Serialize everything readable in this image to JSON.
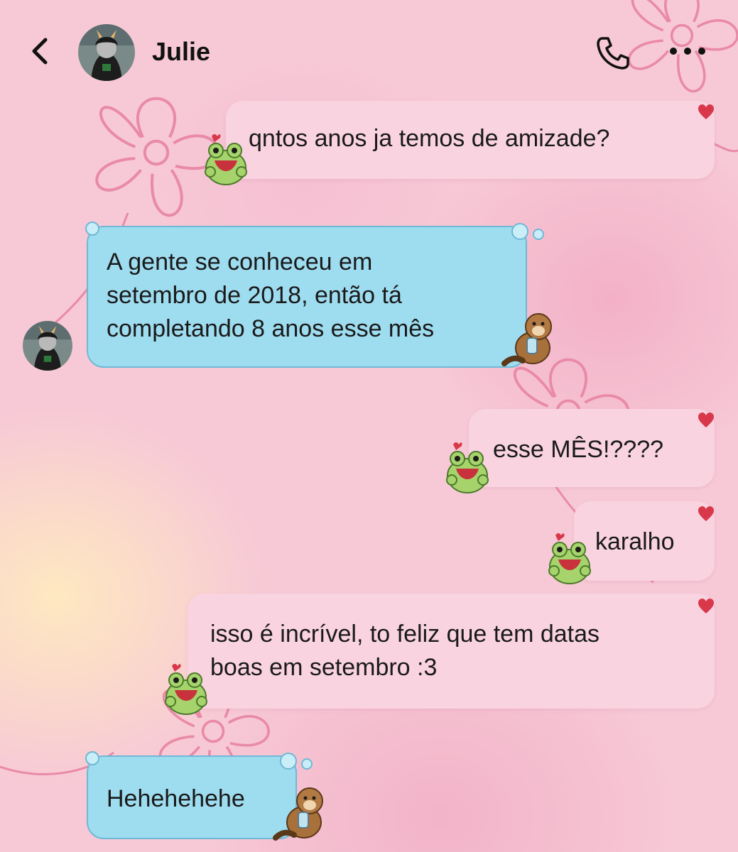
{
  "header": {
    "contact_name": "Julie"
  },
  "messages": [
    {
      "sender": "me",
      "text": "qntos anos ja temos de amizade?"
    },
    {
      "sender": "them",
      "text": "A gente se conheceu em\nsetembro de 2018, então tá\ncompletando 8 anos esse mês"
    },
    {
      "sender": "me",
      "text": "esse MÊS!????"
    },
    {
      "sender": "me",
      "text": "karalho"
    },
    {
      "sender": "me",
      "text": "isso é incrível, to feliz que tem datas\nboas em setembro :3"
    },
    {
      "sender": "them",
      "text": "Hehehehehe"
    }
  ],
  "icons": {
    "back": "chevron-left-icon",
    "call": "phone-icon",
    "more": "more-dots-icon",
    "my_sticker": "frog-sticker",
    "their_sticker": "otter-sticker"
  },
  "colors": {
    "my_bubble": "#f9d3e0",
    "their_bubble": "#9edcf0",
    "heart": "#d8384a",
    "background": "#f7c9d6"
  }
}
